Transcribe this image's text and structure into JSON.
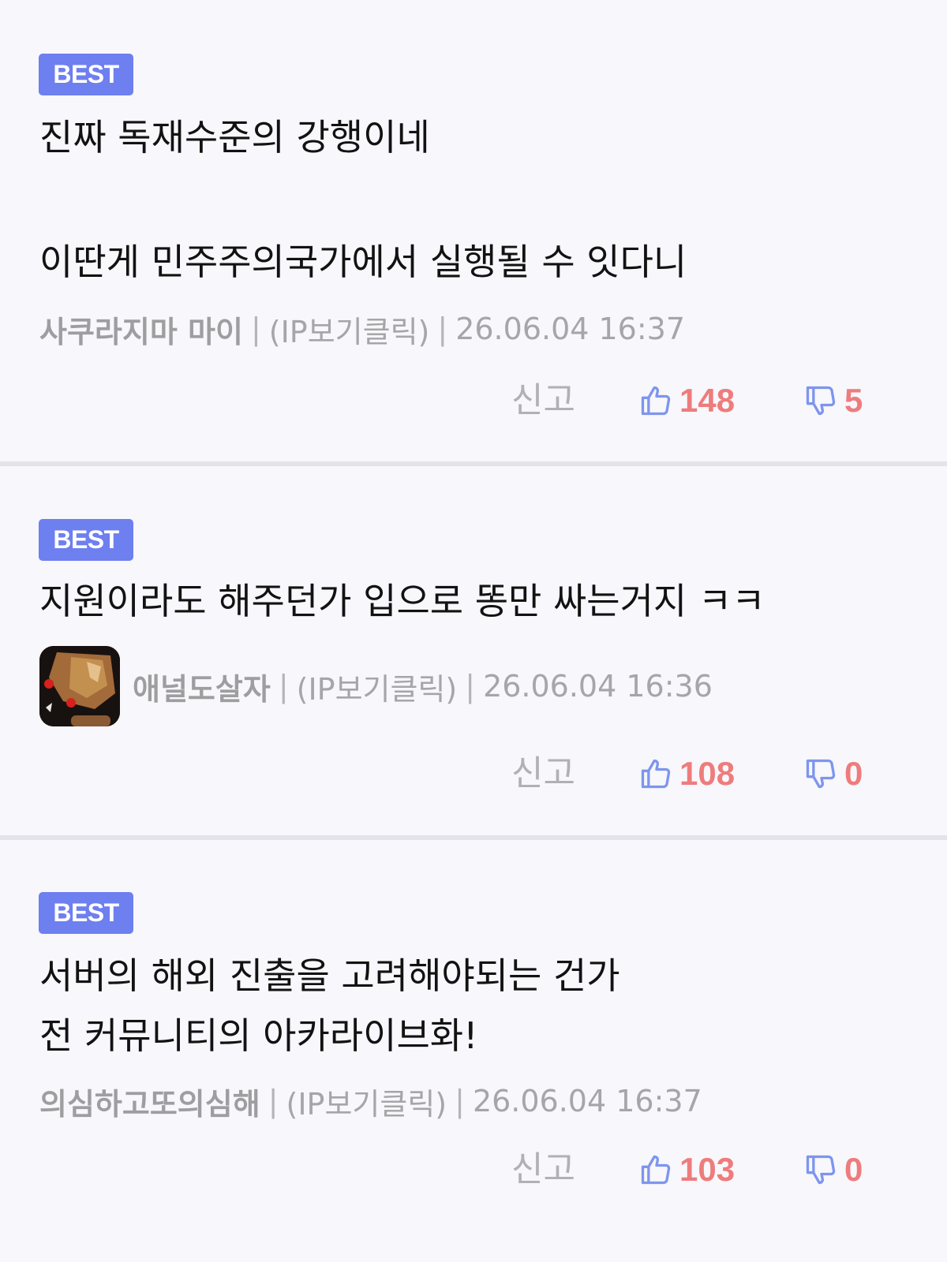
{
  "colors": {
    "badge": "#6e7ff0",
    "like_icon": "#7e95ee",
    "count": "#ee7c7c",
    "meta_text": "#a6a6a8",
    "divider": "#e3e3e9"
  },
  "comments": [
    {
      "badge": "BEST",
      "lines": [
        "진짜 독재수준의 강행이네",
        "이딴게 민주주의국가에서 실행될 수 잇다니"
      ],
      "author": "사쿠라지마 마이",
      "ip": "(IP보기클릭)",
      "time": "26.06.04 16:37",
      "report": "신고",
      "likes": "148",
      "dislikes": "5",
      "like_icon": "thumbs-up-icon",
      "dislike_icon": "thumbs-down-icon"
    },
    {
      "badge": "BEST",
      "lines": [
        "지원이라도 해주던가 입으로 똥만 싸는거지 ㅋㅋ"
      ],
      "author": "애널도살자",
      "ip": "(IP보기클릭)",
      "time": "26.06.04 16:36",
      "report": "신고",
      "likes": "108",
      "dislikes": "0",
      "avatar_icon": "user-avatar",
      "like_icon": "thumbs-up-icon",
      "dislike_icon": "thumbs-down-icon"
    },
    {
      "badge": "BEST",
      "lines": [
        "서버의 해외 진출을 고려해야되는 건가",
        "전 커뮤니티의 아카라이브화!"
      ],
      "author": "의심하고또의심해",
      "ip": "(IP보기클릭)",
      "time": "26.06.04 16:37",
      "report": "신고",
      "likes": "103",
      "dislikes": "0",
      "like_icon": "thumbs-up-icon",
      "dislike_icon": "thumbs-down-icon"
    }
  ]
}
